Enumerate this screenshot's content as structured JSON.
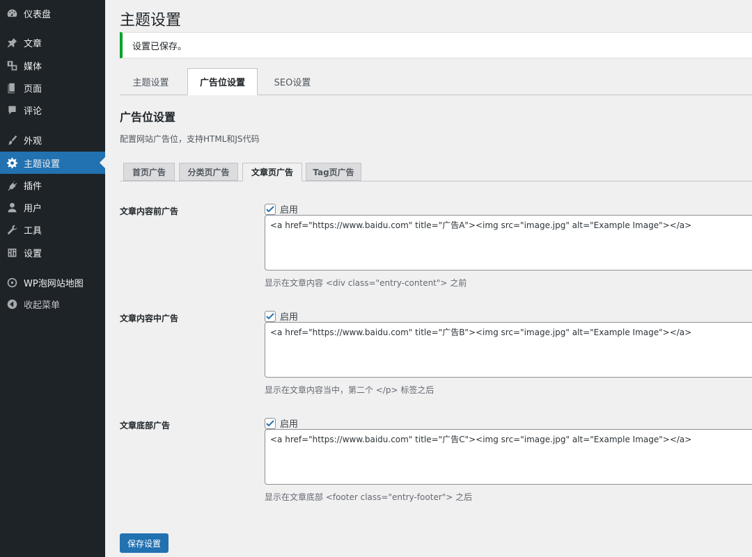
{
  "sidebar": {
    "items": [
      {
        "label": "仪表盘",
        "icon": "dashboard-icon"
      },
      {
        "label": "文章",
        "icon": "pin-icon"
      },
      {
        "label": "媒体",
        "icon": "media-icon"
      },
      {
        "label": "页面",
        "icon": "page-icon"
      },
      {
        "label": "评论",
        "icon": "comment-icon"
      },
      {
        "label": "外观",
        "icon": "brush-icon"
      },
      {
        "label": "主题设置",
        "icon": "gear-icon",
        "active": true
      },
      {
        "label": "插件",
        "icon": "plugin-icon"
      },
      {
        "label": "用户",
        "icon": "user-icon"
      },
      {
        "label": "工具",
        "icon": "wrench-icon"
      },
      {
        "label": "设置",
        "icon": "settings-icon"
      },
      {
        "label": "WP泡网站地图",
        "icon": "sitemap-icon"
      },
      {
        "label": "收起菜单",
        "icon": "collapse-icon"
      }
    ]
  },
  "page": {
    "title": "主题设置",
    "notice": "设置已保存。",
    "tabs": [
      "主题设置",
      "广告位设置",
      "SEO设置"
    ],
    "active_tab": "广告位设置",
    "section_title": "广告位设置",
    "section_desc": "配置网站广告位，支持HTML和JS代码",
    "sub_tabs": [
      "首页广告",
      "分类页广告",
      "文章页广告",
      "Tag页广告"
    ],
    "active_sub_tab": "文章页广告",
    "enable_label": "启用",
    "fields": [
      {
        "label": "文章内容前广告",
        "enabled": true,
        "code": "<a href=\"https://www.baidu.com\" title=\"广告A\"><img src=\"image.jpg\" alt=\"Example Image\"></a>",
        "hint": "显示在文章内容 <div class=\"entry-content\"> 之前"
      },
      {
        "label": "文章内容中广告",
        "enabled": true,
        "code": "<a href=\"https://www.baidu.com\" title=\"广告B\"><img src=\"image.jpg\" alt=\"Example Image\"></a>",
        "hint": "显示在文章内容当中，第二个 </p> 标签之后"
      },
      {
        "label": "文章底部广告",
        "enabled": true,
        "code": "<a href=\"https://www.baidu.com\" title=\"广告C\"><img src=\"image.jpg\" alt=\"Example Image\"></a>",
        "hint": "显示在文章底部 <footer class=\"entry-footer\"> 之后"
      }
    ],
    "save_label": "保存设置"
  },
  "colors": {
    "sidebar_bg": "#1d2327",
    "accent": "#2271b1",
    "notice_success": "#00a32a"
  }
}
